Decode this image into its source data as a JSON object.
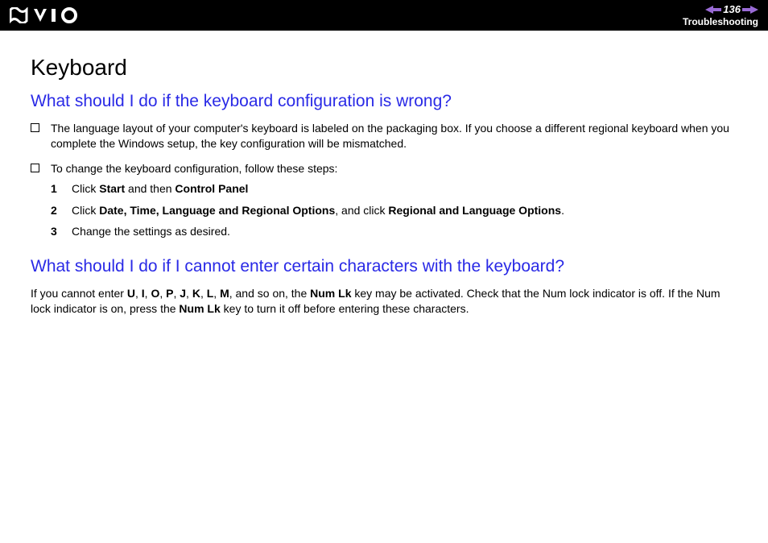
{
  "header": {
    "page_number": "136",
    "section": "Troubleshooting"
  },
  "title": "Keyboard",
  "q1": {
    "heading": "What should I do if the keyboard configuration is wrong?",
    "bullet1": "The language layout of your computer's keyboard is labeled on the packaging box. If you choose a different regional keyboard when you complete the Windows setup, the key configuration will be mismatched.",
    "bullet2": "To change the keyboard configuration, follow these steps:",
    "steps": {
      "n1": "1",
      "s1_a": "Click ",
      "s1_b": "Start",
      "s1_c": " and then ",
      "s1_d": "Control Panel",
      "n2": "2",
      "s2_a": "Click ",
      "s2_b": "Date, Time, Language and Regional Options",
      "s2_c": ", and click ",
      "s2_d": "Regional and Language Options",
      "s2_e": ".",
      "n3": "3",
      "s3": "Change the settings as desired."
    }
  },
  "q2": {
    "heading": "What should I do if I cannot enter certain characters with the keyboard?",
    "p_a": "If you cannot enter ",
    "k_U": "U",
    "c1": ", ",
    "k_I": "I",
    "c2": ", ",
    "k_O": "O",
    "c3": ", ",
    "k_P": "P",
    "c4": ", ",
    "k_J": "J",
    "c5": ", ",
    "k_K": "K",
    "c6": ", ",
    "k_L": "L",
    "c7": ", ",
    "k_M": "M",
    "p_b": ", and so on, the ",
    "numlk1": "Num Lk",
    "p_c": " key may be activated. Check that the Num lock indicator is off. If the Num lock indicator is on, press the ",
    "numlk2": "Num Lk",
    "p_d": " key to turn it off before entering these characters."
  }
}
